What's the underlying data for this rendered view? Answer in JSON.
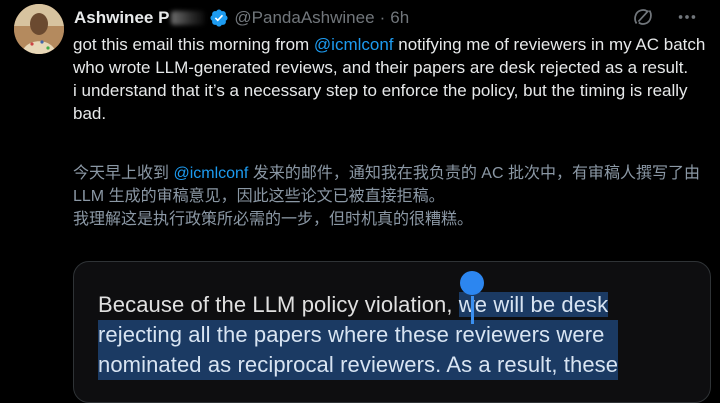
{
  "author": {
    "display_name": "Ashwinee P",
    "handle": "@PandaAshwinee",
    "separator": "·",
    "time": "6h"
  },
  "tweet": {
    "lines": [
      {
        "before": "got this email this morning from ",
        "mention": "@icmlconf",
        "after": " notifying me of reviewers in my AC batch who wrote LLM-generated reviews, and their papers are desk rejected as a result."
      },
      {
        "text": "i understand that it’s a necessary step to enforce the policy, but the timing is really bad."
      }
    ]
  },
  "translation": {
    "line1_before": "今天早上收到 ",
    "line1_mention": "@icmlconf",
    "line1_after": " 发来的邮件，通知我在我负责的 AC 批次中，有审稿人撰写了由 LLM 生成的审稿意见，因此这些论文已被直接拒稿。",
    "line2": "我理解这是执行政策所必需的一步，但时机真的很糟糕。"
  },
  "media": {
    "line1_plain": "Because of the LLM policy violation, ",
    "line1_highlight": "we will be desk",
    "line2": "rejecting all the papers where these reviewers were",
    "line3": "nominated as reciprocal reviewers. As a result, these"
  },
  "colors": {
    "background": "#000000",
    "text": "#e7e9ea",
    "muted": "#71767b",
    "link": "#1d9bf0",
    "verified": "#1d9bf0",
    "highlight": "#1b3a63",
    "selection_handle": "#2c86f0"
  },
  "icons": {
    "verified": "verified-badge-icon",
    "grok": "grok-icon",
    "more": "more-options-icon"
  }
}
